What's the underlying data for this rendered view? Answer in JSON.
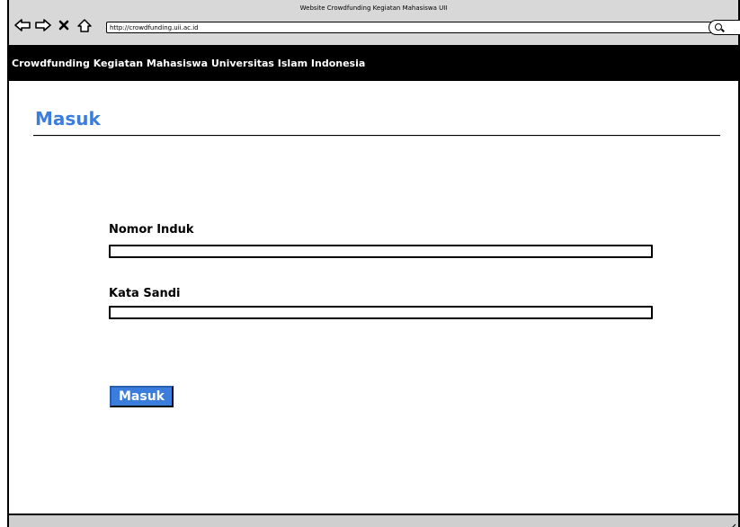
{
  "window": {
    "title": "Website Crowdfunding Kegiatan Mahasiswa UII",
    "url": "http://crowdfunding.uii.ac.id"
  },
  "nav_icons": [
    "back-arrow-icon",
    "forward-arrow-icon",
    "stop-icon",
    "home-icon",
    "search-icon"
  ],
  "site": {
    "header_title": "Crowdfunding Kegiatan Mahasiswa Universitas Islam Indonesia"
  },
  "login": {
    "heading": "Masuk",
    "id_label": "Nomor Induk",
    "id_value": "",
    "password_label": "Kata Sandi",
    "password_value": "",
    "submit_label": "Masuk"
  },
  "colors": {
    "accent": "#3b7ddd",
    "header_background": "#000000",
    "chrome_background": "#d8d8d8"
  }
}
